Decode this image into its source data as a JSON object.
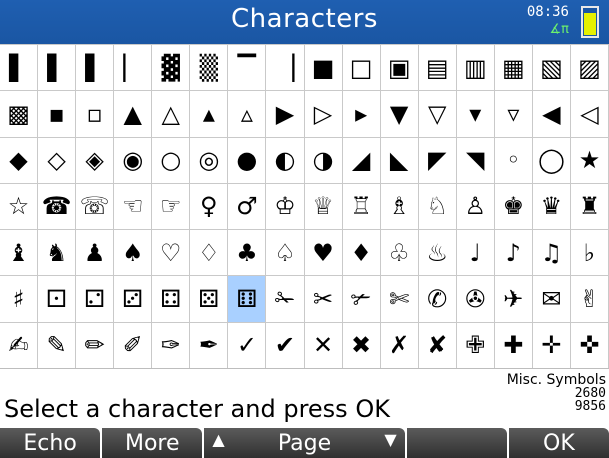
{
  "app": {
    "title": "Characters",
    "clock": "08:36",
    "angle_mode": "∡π"
  },
  "grid": {
    "selected_index": 86,
    "rows": [
      [
        "▌",
        "▌",
        "▌",
        "▏",
        "▓",
        "▒",
        "▔",
        "▕",
        "■",
        "□",
        "▣",
        "▤",
        "▥",
        "▦",
        "▧",
        "▨"
      ],
      [
        "▩",
        "▪",
        "▫",
        "▲",
        "△",
        "▴",
        "▵",
        "▶",
        "▷",
        "▸",
        "▼",
        "▽",
        "▾",
        "▿",
        "◀",
        "◁"
      ],
      [
        "◆",
        "◇",
        "◈",
        "◉",
        "○",
        "◎",
        "●",
        "◐",
        "◑",
        "◢",
        "◣",
        "◤",
        "◥",
        "◦",
        "◯",
        "★"
      ],
      [
        "☆",
        "☎",
        "☏",
        "☜",
        "☞",
        "♀",
        "♂",
        "♔",
        "♕",
        "♖",
        "♗",
        "♘",
        "♙",
        "♚",
        "♛",
        "♜"
      ],
      [
        "♝",
        "♞",
        "♟",
        "♠",
        "♡",
        "♢",
        "♣",
        "♤",
        "♥",
        "♦",
        "♧",
        "♨",
        "♩",
        "♪",
        "♫",
        "♭"
      ],
      [
        "♯",
        "⚀",
        "⚁",
        "⚂",
        "⚃",
        "⚄",
        "⚅",
        "✁",
        "✂",
        "✃",
        "✄",
        "✆",
        "✇",
        "✈",
        "✉",
        "✌"
      ],
      [
        "✍",
        "✎",
        "✏",
        "✐",
        "✑",
        "✒",
        "✓",
        "✔",
        "✕",
        "✖",
        "✗",
        "✘",
        "✙",
        "✚",
        "✛",
        "✜"
      ]
    ]
  },
  "status": {
    "prompt": "Select a character and press OK",
    "block_name": "Misc. Symbols",
    "hex_code": "2680",
    "dec_code": "9856"
  },
  "menu": {
    "echo": "Echo",
    "more": "More",
    "page": "Page",
    "page_left_icon": "▲",
    "page_right_icon": "▼",
    "ok": "OK"
  }
}
